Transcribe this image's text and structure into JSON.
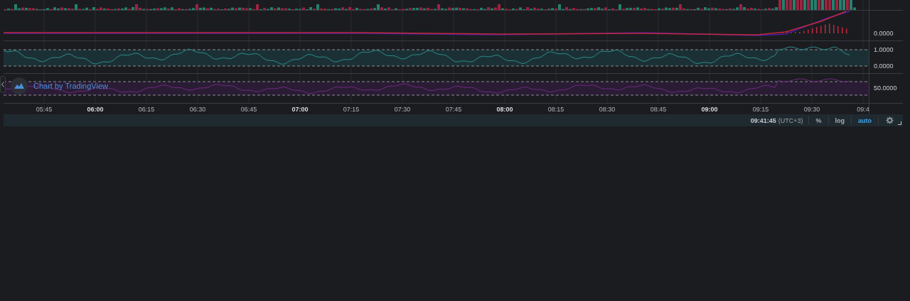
{
  "macd_pane": {
    "axis_labels": [
      "0.0000"
    ]
  },
  "stoch_pane": {
    "axis_labels": [
      "1.0000",
      "0.0000"
    ]
  },
  "rsi_pane": {
    "axis_labels": [
      "50.0000"
    ]
  },
  "attribution": {
    "text": "Chart by TradingView"
  },
  "time_axis": [
    {
      "label": "05:45",
      "kind": "minor"
    },
    {
      "label": "06:00",
      "kind": "hour"
    },
    {
      "label": "06:15",
      "kind": "minor"
    },
    {
      "label": "06:30",
      "kind": "minor"
    },
    {
      "label": "06:45",
      "kind": "minor"
    },
    {
      "label": "07:00",
      "kind": "hour"
    },
    {
      "label": "07:15",
      "kind": "minor"
    },
    {
      "label": "07:30",
      "kind": "minor"
    },
    {
      "label": "07:45",
      "kind": "minor"
    },
    {
      "label": "08:00",
      "kind": "hour"
    },
    {
      "label": "08:15",
      "kind": "minor"
    },
    {
      "label": "08:30",
      "kind": "minor"
    },
    {
      "label": "08:45",
      "kind": "minor"
    },
    {
      "label": "09:00",
      "kind": "hour"
    },
    {
      "label": "09:15",
      "kind": "minor"
    },
    {
      "label": "09:30",
      "kind": "minor"
    },
    {
      "label": "09:4",
      "kind": "minor"
    }
  ],
  "status_bar": {
    "time": "09:41:45",
    "timezone": "(UTC+3)",
    "options": [
      {
        "label": "%",
        "selected": false
      },
      {
        "label": "log",
        "selected": false
      },
      {
        "label": "auto",
        "selected": true
      }
    ]
  }
}
